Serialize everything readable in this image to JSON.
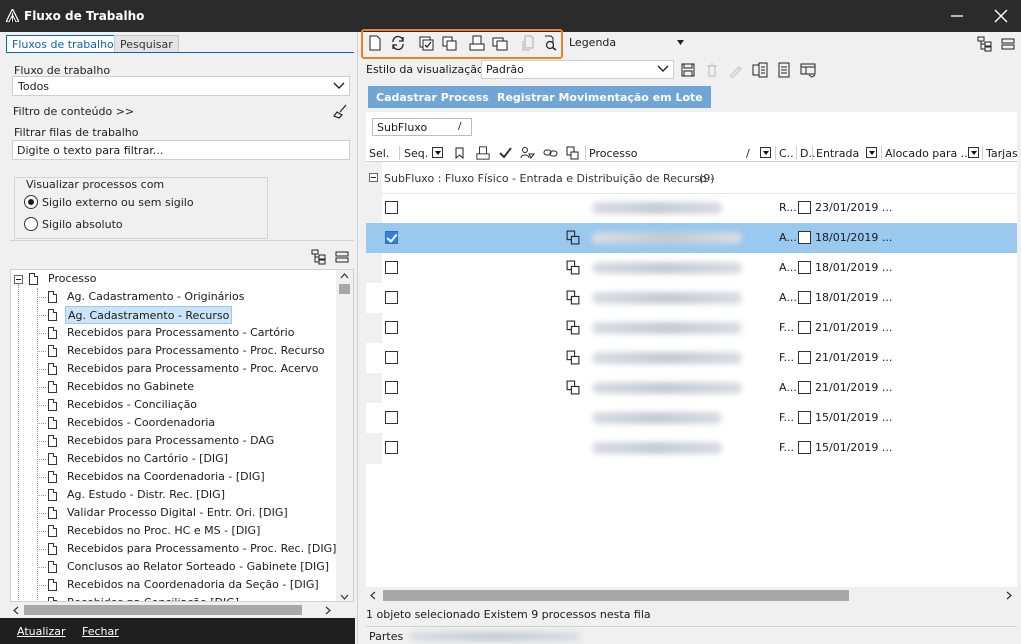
{
  "window": {
    "title": "Fluxo de Trabalho"
  },
  "left": {
    "tabs": [
      {
        "label": "Fluxos de trabalho",
        "active": true
      },
      {
        "label": "Pesquisar",
        "active": false
      }
    ],
    "workflow_label": "Fluxo de trabalho",
    "workflow_value": "Todos",
    "content_filter": "Filtro de conteúdo >>",
    "queue_filter_label": "Filtrar filas de trabalho",
    "queue_filter_placeholder": "Digite o texto para filtrar...",
    "visualize_label": "Visualizar processos com",
    "radios": [
      {
        "label": "Sigilo externo ou sem sigilo",
        "checked": true
      },
      {
        "label": "Sigilo absoluto",
        "checked": false
      }
    ],
    "tree_root": "Processo",
    "tree_items": [
      {
        "label": "Ag. Cadastramento - Originários",
        "selected": false
      },
      {
        "label": "Ag. Cadastramento - Recurso",
        "selected": true
      },
      {
        "label": "Recebidos para Processamento - Cartório",
        "selected": false
      },
      {
        "label": "Recebidos para Processamento - Proc. Recurso",
        "selected": false
      },
      {
        "label": "Recebidos para Processamento - Proc. Acervo",
        "selected": false
      },
      {
        "label": "Recebidos no Gabinete",
        "selected": false
      },
      {
        "label": "Recebidos - Conciliação",
        "selected": false
      },
      {
        "label": "Recebidos - Coordenadoria",
        "selected": false
      },
      {
        "label": "Recebidos para Processamento - DAG",
        "selected": false
      },
      {
        "label": "Recebidos no Cartório - [DIG]",
        "selected": false
      },
      {
        "label": "Recebidos na Coordenadoria - [DIG]",
        "selected": false
      },
      {
        "label": "Ag. Estudo - Distr. Rec. [DIG]",
        "selected": false
      },
      {
        "label": "Validar Processo Digital - Entr. Ori. [DIG]",
        "selected": false
      },
      {
        "label": "Recebidos no Proc. HC e MS - [DIG]",
        "selected": false
      },
      {
        "label": "Recebidos para Processamento - Proc. Rec. [DIG]",
        "selected": false
      },
      {
        "label": "Conclusos ao Relator Sorteado - Gabinete [DIG]",
        "selected": false
      },
      {
        "label": "Recebidos na Coordenadoria da Seção - [DIG]",
        "selected": false
      },
      {
        "label": "Recebidos na Conciliação [DIG]",
        "selected": false
      }
    ],
    "buttons": {
      "refresh": "Atualizar",
      "close": "Fechar"
    }
  },
  "right": {
    "legend_label": "Legenda",
    "view_style_label": "Estilo da visualização",
    "view_style_value": "Padrão",
    "action_buttons": [
      "Cadastrar Processo",
      "Registrar Movimentação em Lote"
    ],
    "group_chip": "SubFluxo",
    "columns": [
      "Sel.",
      "Seq.",
      "Processo",
      "C..",
      "D..",
      "Entrada",
      "Alocado para ...",
      "Tarjas"
    ],
    "group_row": {
      "label": "SubFluxo : Fluxo Físico - Entrada e Distribuição de Recurso -",
      "count": "(9)"
    },
    "rows": [
      {
        "selected": false,
        "c": "R...",
        "date": "23/01/2019 ...",
        "linked": false
      },
      {
        "selected": true,
        "c": "A...",
        "date": "18/01/2019 ...",
        "linked": true
      },
      {
        "selected": false,
        "c": "A...",
        "date": "18/01/2019 ...",
        "linked": true
      },
      {
        "selected": false,
        "c": "A...",
        "date": "18/01/2019 ...",
        "linked": true
      },
      {
        "selected": false,
        "c": "F...",
        "date": "21/01/2019 ...",
        "linked": true
      },
      {
        "selected": false,
        "c": "F...",
        "date": "21/01/2019 ...",
        "linked": true
      },
      {
        "selected": false,
        "c": "A...",
        "date": "21/01/2019 ...",
        "linked": true
      },
      {
        "selected": false,
        "c": "F...",
        "date": "15/01/2019 ...",
        "linked": false
      },
      {
        "selected": false,
        "c": "F...",
        "date": "15/01/2019 ...",
        "linked": false
      }
    ],
    "status": "1 objeto selecionado  Existem 9 processos nesta fila",
    "parts_label": "Partes"
  },
  "colors": {
    "accent": "#e8822a",
    "tab_blue": "#0a64c2",
    "button_blue": "#6fa6d6",
    "selected_row": "#99c9ef"
  }
}
